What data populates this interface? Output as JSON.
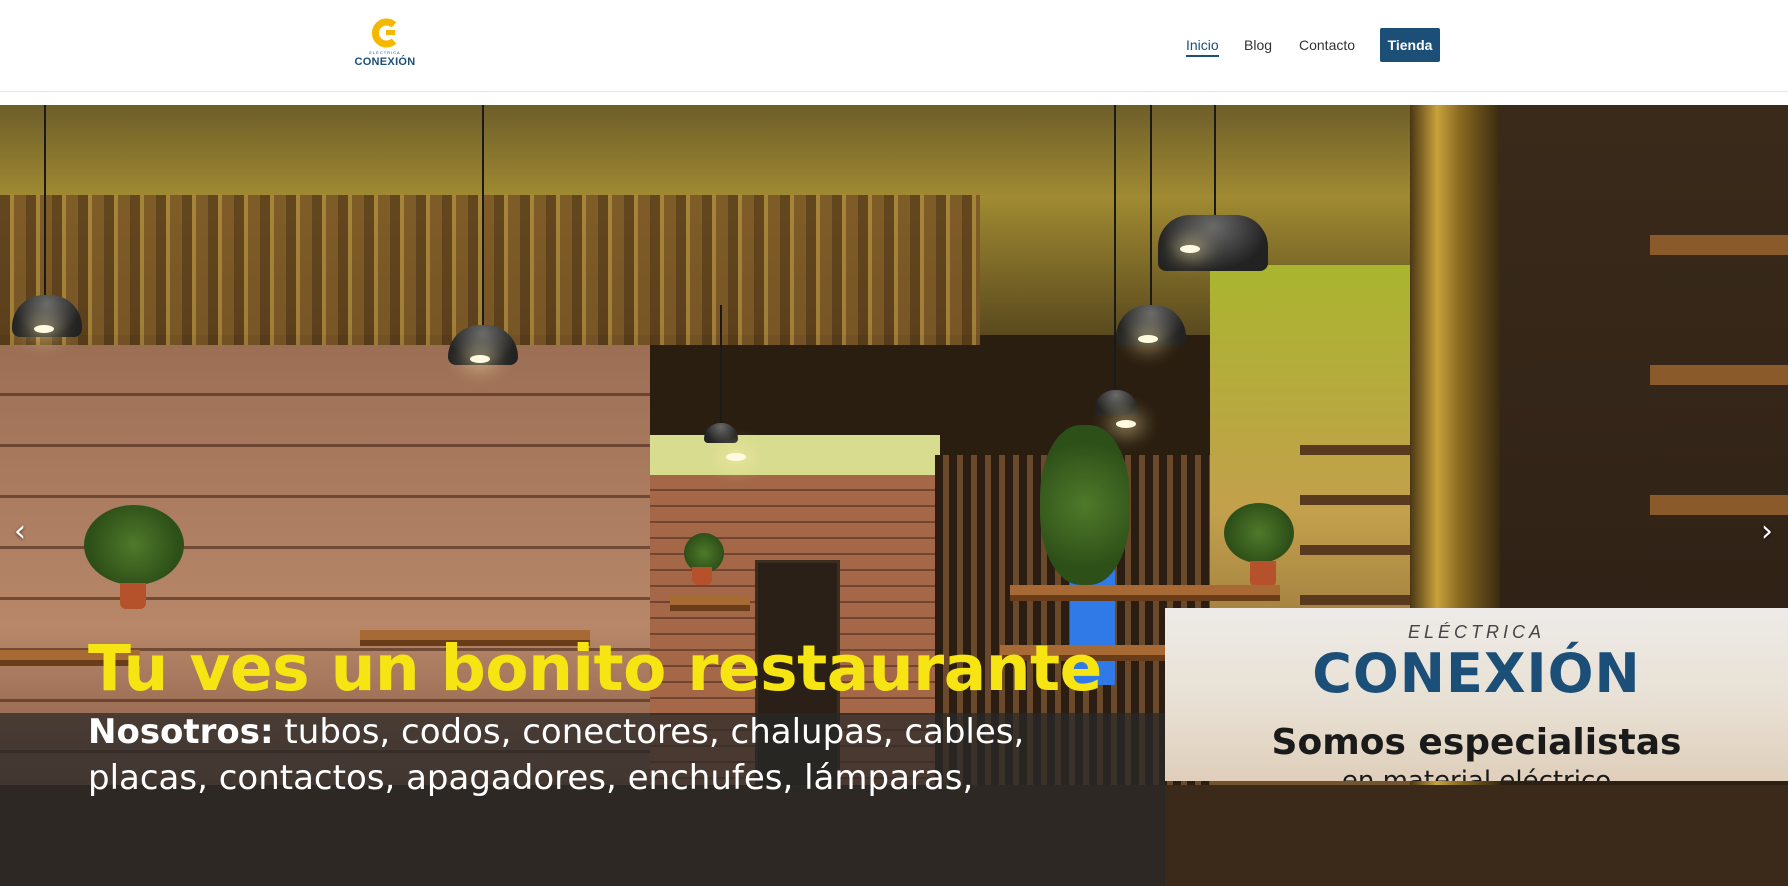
{
  "brand": {
    "logo_sub": "ELÉCTRICA",
    "logo_name": "CONEXIÓN",
    "accent": "#1c4f78",
    "logo_accent": "#f5b800"
  },
  "nav": {
    "items": [
      {
        "label": "Inicio",
        "active": true
      },
      {
        "label": "Blog",
        "active": false
      },
      {
        "label": "Contacto",
        "active": false
      }
    ],
    "shop_label": "Tienda"
  },
  "slider": {
    "prev_icon": "chevron-left-icon",
    "next_icon": "chevron-right-icon",
    "headline": "Tu ves un bonito restaurante",
    "subline_bold": "Nosotros:",
    "subline_rest": " tubos, codos, conectores, chalupas, cables,",
    "subline2": "placas, contactos, apagadores, enchufes, lámparas,",
    "headline_color": "#f6e513"
  },
  "promo": {
    "kicker": "ELÉCTRICA",
    "brand": "CONEXIÓN",
    "title": "Somos especialistas",
    "sub": "en material eléctrico"
  }
}
